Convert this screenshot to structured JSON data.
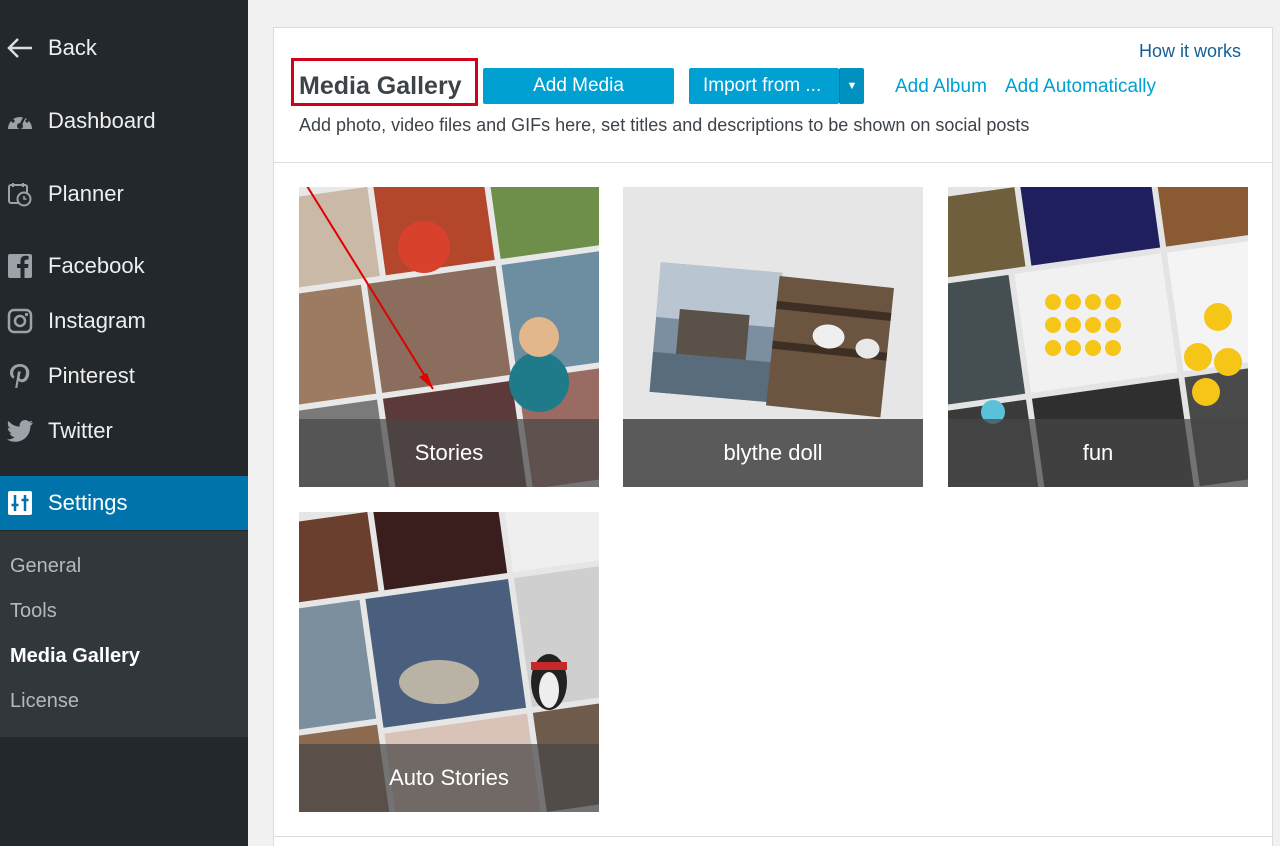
{
  "sidebar": {
    "items": [
      {
        "label": "Back",
        "icon": "arrow-left-icon"
      },
      {
        "label": "Dashboard",
        "icon": "dashboard-icon"
      },
      {
        "label": "Planner",
        "icon": "calendar-clock-icon"
      },
      {
        "label": "Facebook",
        "icon": "facebook-icon"
      },
      {
        "label": "Instagram",
        "icon": "instagram-icon"
      },
      {
        "label": "Pinterest",
        "icon": "pinterest-icon"
      },
      {
        "label": "Twitter",
        "icon": "twitter-icon"
      },
      {
        "label": "Settings",
        "icon": "settings-icon"
      }
    ],
    "submenu": [
      {
        "label": "General"
      },
      {
        "label": "Tools"
      },
      {
        "label": "Media Gallery"
      },
      {
        "label": "License"
      }
    ]
  },
  "header": {
    "title": "Media Gallery",
    "add_media_label": "Add Media",
    "import_label": "Import from ...",
    "add_album_label": "Add Album",
    "add_auto_label": "Add Automatically",
    "how_it_works_label": "How it works",
    "subtitle": "Add photo, video files and GIFs here, set titles and descriptions to be shown on social posts"
  },
  "albums": [
    {
      "label": "Stories"
    },
    {
      "label": "blythe doll"
    },
    {
      "label": "fun"
    },
    {
      "label": "Auto Stories"
    }
  ],
  "colors": {
    "sidebar_bg": "#23282d",
    "accent": "#0073aa",
    "button": "#00a0d2",
    "annotation": "#d0021b"
  }
}
